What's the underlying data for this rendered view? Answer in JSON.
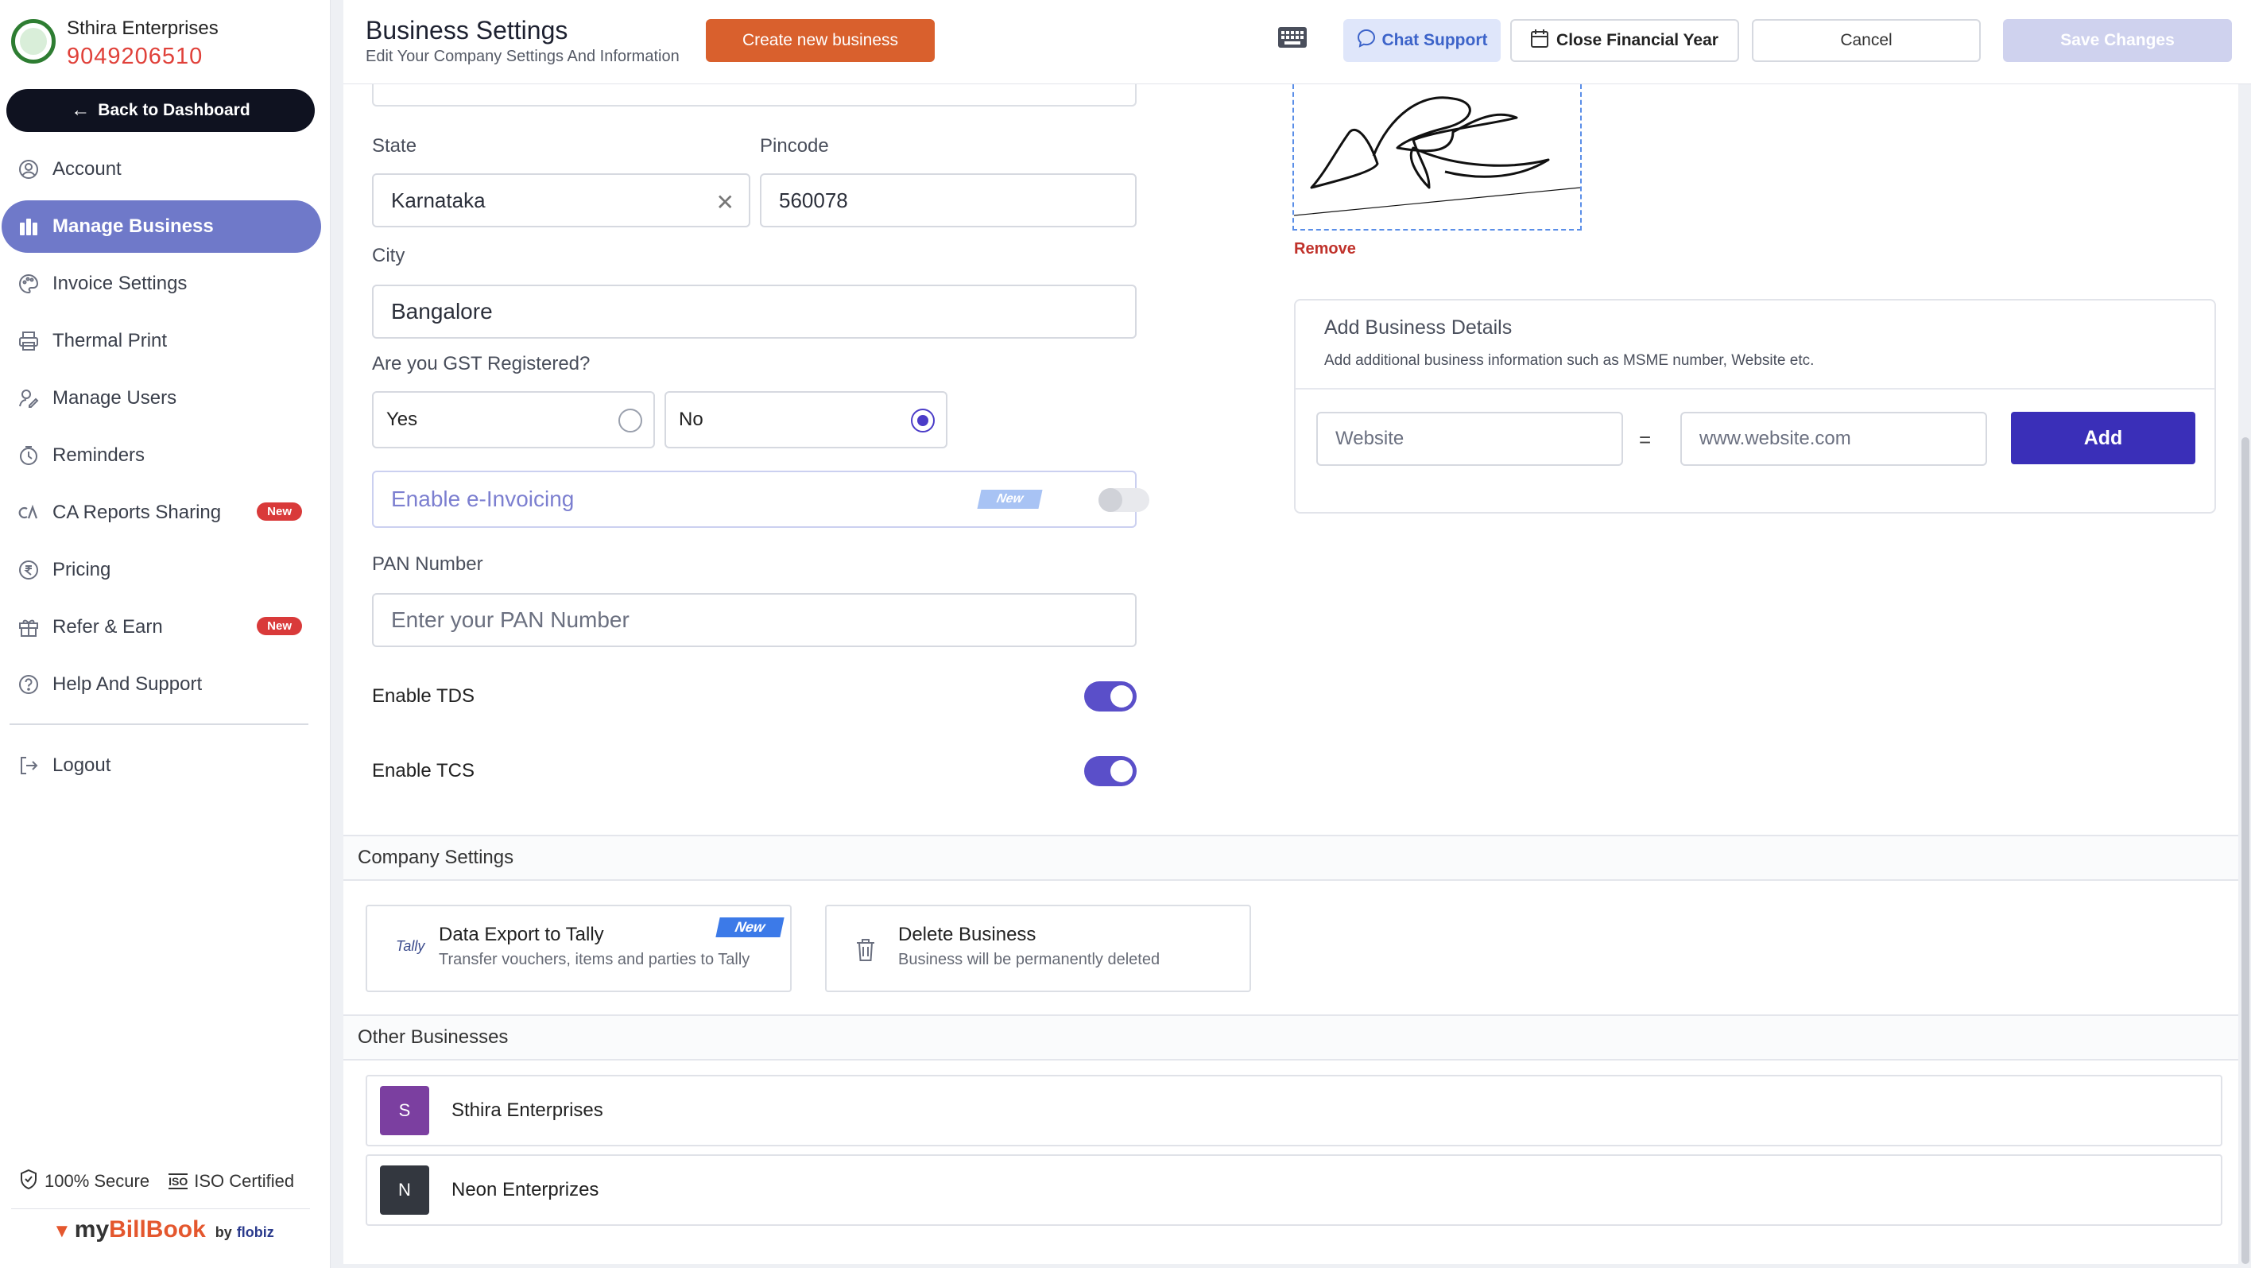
{
  "sidebar": {
    "business_name": "Sthira Enterprises",
    "business_phone": "9049206510",
    "back_label": "Back to Dashboard",
    "items": [
      {
        "label": "Account",
        "icon": "user-circle-icon",
        "active": false,
        "badge": ""
      },
      {
        "label": "Manage Business",
        "icon": "building-icon",
        "active": true,
        "badge": ""
      },
      {
        "label": "Invoice Settings",
        "icon": "palette-icon",
        "active": false,
        "badge": ""
      },
      {
        "label": "Thermal Print",
        "icon": "printer-icon",
        "active": false,
        "badge": ""
      },
      {
        "label": "Manage Users",
        "icon": "users-icon",
        "active": false,
        "badge": ""
      },
      {
        "label": "Reminders",
        "icon": "clock-icon",
        "active": false,
        "badge": ""
      },
      {
        "label": "CA Reports Sharing",
        "icon": "ca-icon",
        "active": false,
        "badge": "New"
      },
      {
        "label": "Pricing",
        "icon": "rupee-icon",
        "active": false,
        "badge": ""
      },
      {
        "label": "Refer & Earn",
        "icon": "gift-icon",
        "active": false,
        "badge": "New"
      },
      {
        "label": "Help And Support",
        "icon": "help-icon",
        "active": false,
        "badge": ""
      }
    ],
    "logout_label": "Logout",
    "secure_label": "100% Secure",
    "iso_label": "ISO Certified",
    "brand": {
      "name_part1": "my",
      "name_part2": "Bill",
      "name_part3": "Book",
      "by": "by",
      "company": "flobiz"
    }
  },
  "header": {
    "title": "Business Settings",
    "subtitle": "Edit Your Company Settings And Information",
    "create_label": "Create new business",
    "chat_label": "Chat Support",
    "close_fy_label": "Close Financial Year",
    "cancel_label": "Cancel",
    "save_label": "Save Changes"
  },
  "form": {
    "state_label": "State",
    "state_value": "Karnataka",
    "pincode_label": "Pincode",
    "pincode_value": "560078",
    "city_label": "City",
    "city_value": "Bangalore",
    "gst_question": "Are you GST Registered?",
    "gst_yes": "Yes",
    "gst_no": "No",
    "gst_selected": "No",
    "einvoice_label": "Enable e-Invoicing",
    "einvoice_badge": "New",
    "einvoice_enabled": false,
    "pan_label": "PAN Number",
    "pan_placeholder": "Enter your PAN Number",
    "tds_label": "Enable TDS",
    "tds_enabled": true,
    "tcs_label": "Enable TCS",
    "tcs_enabled": true
  },
  "signature": {
    "remove_label": "Remove"
  },
  "business_details": {
    "title": "Add Business Details",
    "subtitle": "Add additional business information such as MSME number, Website etc.",
    "key_value": "Website",
    "equals": "=",
    "value_placeholder": "www.website.com",
    "add_label": "Add"
  },
  "company_settings": {
    "heading": "Company Settings",
    "tally_title": "Data Export to Tally",
    "tally_sub": "Transfer vouchers, items and parties to Tally",
    "tally_badge": "New",
    "tally_logo": "Tally",
    "delete_title": "Delete Business",
    "delete_sub": "Business will be permanently deleted"
  },
  "other_businesses": {
    "heading": "Other Businesses",
    "items": [
      {
        "initial": "S",
        "name": "Sthira Enterprises",
        "color": "#7b3fa0"
      },
      {
        "initial": "N",
        "name": "Neon Enterprizes",
        "color": "#33373f"
      }
    ]
  },
  "colors": {
    "accent": "#3a2fb8",
    "create_button": "#d9602d",
    "active_nav": "#6f79c9",
    "new_badge": "#d93a3a"
  }
}
